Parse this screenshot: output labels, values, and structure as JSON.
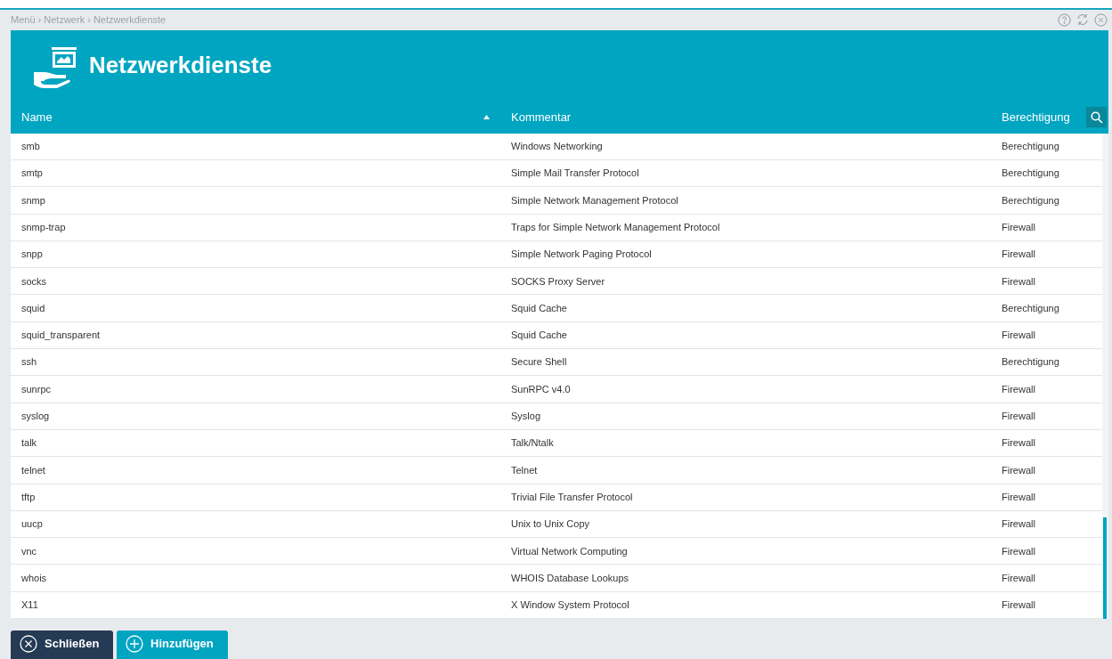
{
  "breadcrumb": "Menü › Netzwerk › Netzwerkdienste",
  "title": "Netzwerkdienste",
  "columns": [
    {
      "label": "Name",
      "sorted": true
    },
    {
      "label": "Kommentar",
      "sorted": false
    },
    {
      "label": "Berechtigung",
      "sorted": false
    }
  ],
  "rows": [
    [
      "smb",
      "Windows Networking",
      "Berechtigung"
    ],
    [
      "smtp",
      "Simple Mail Transfer Protocol",
      "Berechtigung"
    ],
    [
      "snmp",
      "Simple Network Management Protocol",
      "Berechtigung"
    ],
    [
      "snmp-trap",
      "Traps for Simple Network Management Protocol",
      "Firewall"
    ],
    [
      "snpp",
      "Simple Network Paging Protocol",
      "Firewall"
    ],
    [
      "socks",
      "SOCKS Proxy Server",
      "Firewall"
    ],
    [
      "squid",
      "Squid Cache",
      "Berechtigung"
    ],
    [
      "squid_transparent",
      "Squid Cache",
      "Firewall"
    ],
    [
      "ssh",
      "Secure Shell",
      "Berechtigung"
    ],
    [
      "sunrpc",
      "SunRPC v4.0",
      "Firewall"
    ],
    [
      "syslog",
      "Syslog",
      "Firewall"
    ],
    [
      "talk",
      "Talk/Ntalk",
      "Firewall"
    ],
    [
      "telnet",
      "Telnet",
      "Firewall"
    ],
    [
      "tftp",
      "Trivial File Transfer Protocol",
      "Firewall"
    ],
    [
      "uucp",
      "Unix to Unix Copy",
      "Firewall"
    ],
    [
      "vnc",
      "Virtual Network Computing",
      "Firewall"
    ],
    [
      "whois",
      "WHOIS Database Lookups",
      "Firewall"
    ],
    [
      "X11",
      "X Window System Protocol",
      "Firewall"
    ]
  ],
  "buttons": [
    {
      "label": "Schließen",
      "kind": "close"
    },
    {
      "label": "Hinzufügen",
      "kind": "add"
    }
  ]
}
